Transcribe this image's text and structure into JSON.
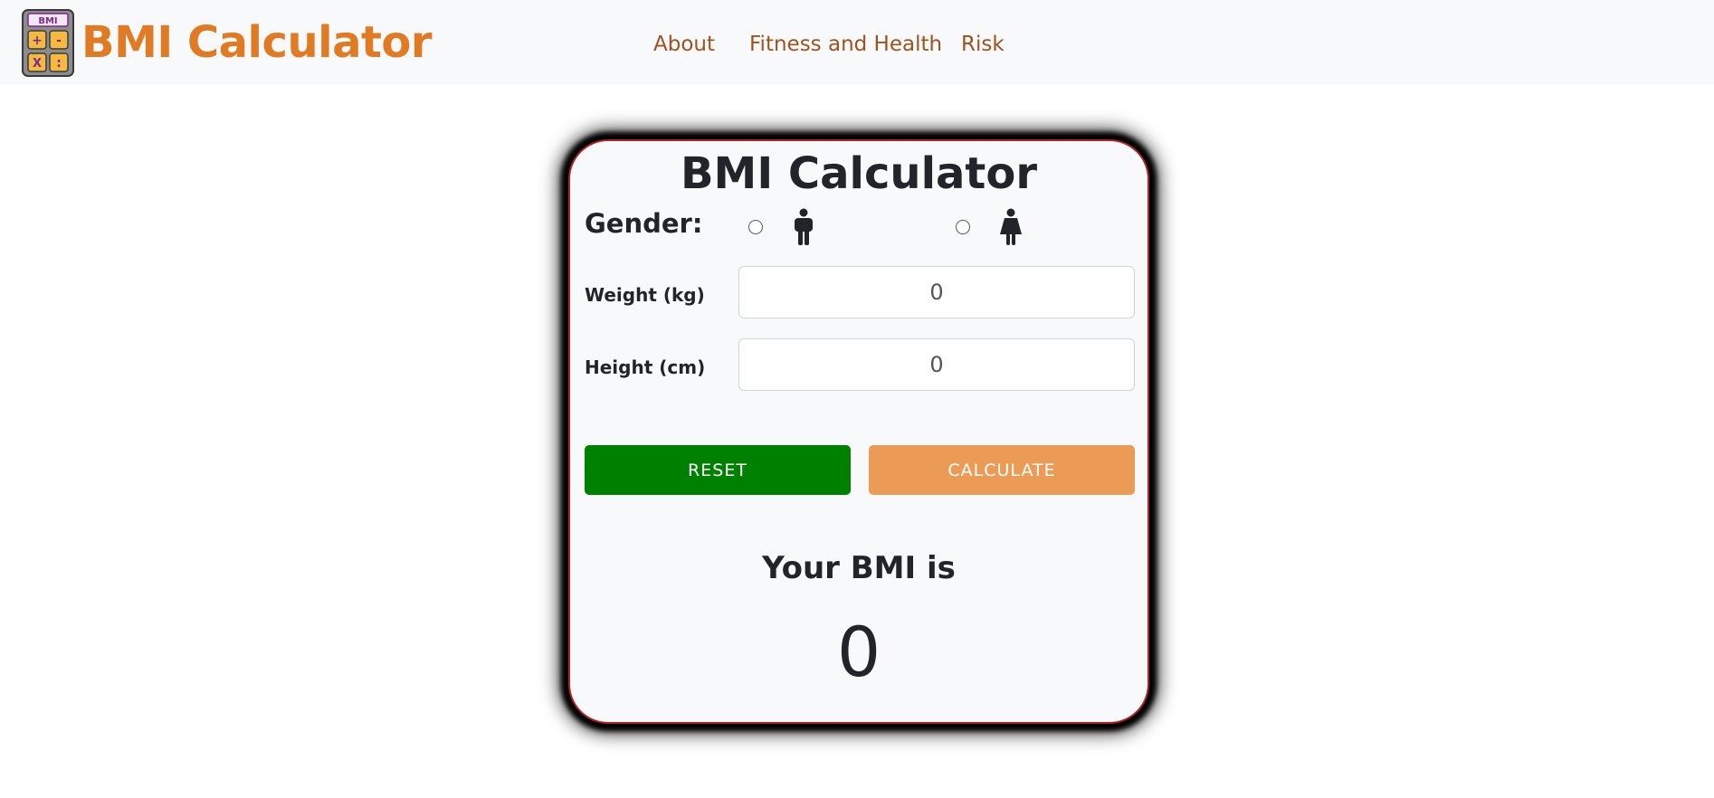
{
  "navbar": {
    "brand_title": "BMI Calculator",
    "logo_text": "BMI",
    "logo_keys": [
      "+",
      "-",
      "X",
      ":"
    ],
    "links": [
      {
        "label": "About"
      },
      {
        "label": "Fitness and Health"
      },
      {
        "label": "Risk"
      }
    ]
  },
  "card": {
    "title": "BMI Calculator",
    "gender_label": "Gender:",
    "gender_options": [
      {
        "icon": "male-icon",
        "selected": false
      },
      {
        "icon": "female-icon",
        "selected": false
      }
    ],
    "weight": {
      "label": "Weight (kg)",
      "value": "0"
    },
    "height": {
      "label": "Height (cm)",
      "value": "0"
    },
    "reset_label": "RESET",
    "calculate_label": "CALCULATE",
    "result_label": "Your BMI is",
    "result_value": "0"
  },
  "colors": {
    "brand": "#e07b24",
    "nav_link": "#a0521e",
    "reset": "#008000",
    "calculate": "#eb9b56",
    "card_border": "#b22222"
  }
}
